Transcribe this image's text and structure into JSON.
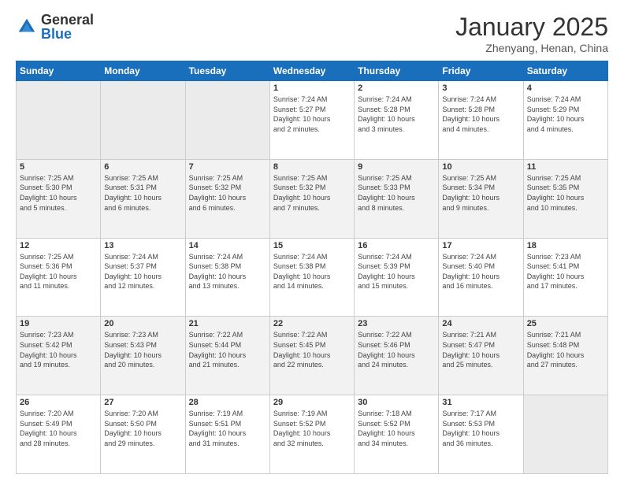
{
  "logo": {
    "general": "General",
    "blue": "Blue"
  },
  "title": "January 2025",
  "location": "Zhenyang, Henan, China",
  "days_of_week": [
    "Sunday",
    "Monday",
    "Tuesday",
    "Wednesday",
    "Thursday",
    "Friday",
    "Saturday"
  ],
  "weeks": [
    [
      {
        "day": null,
        "info": null
      },
      {
        "day": null,
        "info": null
      },
      {
        "day": null,
        "info": null
      },
      {
        "day": "1",
        "info": "Sunrise: 7:24 AM\nSunset: 5:27 PM\nDaylight: 10 hours\nand 2 minutes."
      },
      {
        "day": "2",
        "info": "Sunrise: 7:24 AM\nSunset: 5:28 PM\nDaylight: 10 hours\nand 3 minutes."
      },
      {
        "day": "3",
        "info": "Sunrise: 7:24 AM\nSunset: 5:28 PM\nDaylight: 10 hours\nand 4 minutes."
      },
      {
        "day": "4",
        "info": "Sunrise: 7:24 AM\nSunset: 5:29 PM\nDaylight: 10 hours\nand 4 minutes."
      }
    ],
    [
      {
        "day": "5",
        "info": "Sunrise: 7:25 AM\nSunset: 5:30 PM\nDaylight: 10 hours\nand 5 minutes."
      },
      {
        "day": "6",
        "info": "Sunrise: 7:25 AM\nSunset: 5:31 PM\nDaylight: 10 hours\nand 6 minutes."
      },
      {
        "day": "7",
        "info": "Sunrise: 7:25 AM\nSunset: 5:32 PM\nDaylight: 10 hours\nand 6 minutes."
      },
      {
        "day": "8",
        "info": "Sunrise: 7:25 AM\nSunset: 5:32 PM\nDaylight: 10 hours\nand 7 minutes."
      },
      {
        "day": "9",
        "info": "Sunrise: 7:25 AM\nSunset: 5:33 PM\nDaylight: 10 hours\nand 8 minutes."
      },
      {
        "day": "10",
        "info": "Sunrise: 7:25 AM\nSunset: 5:34 PM\nDaylight: 10 hours\nand 9 minutes."
      },
      {
        "day": "11",
        "info": "Sunrise: 7:25 AM\nSunset: 5:35 PM\nDaylight: 10 hours\nand 10 minutes."
      }
    ],
    [
      {
        "day": "12",
        "info": "Sunrise: 7:25 AM\nSunset: 5:36 PM\nDaylight: 10 hours\nand 11 minutes."
      },
      {
        "day": "13",
        "info": "Sunrise: 7:24 AM\nSunset: 5:37 PM\nDaylight: 10 hours\nand 12 minutes."
      },
      {
        "day": "14",
        "info": "Sunrise: 7:24 AM\nSunset: 5:38 PM\nDaylight: 10 hours\nand 13 minutes."
      },
      {
        "day": "15",
        "info": "Sunrise: 7:24 AM\nSunset: 5:38 PM\nDaylight: 10 hours\nand 14 minutes."
      },
      {
        "day": "16",
        "info": "Sunrise: 7:24 AM\nSunset: 5:39 PM\nDaylight: 10 hours\nand 15 minutes."
      },
      {
        "day": "17",
        "info": "Sunrise: 7:24 AM\nSunset: 5:40 PM\nDaylight: 10 hours\nand 16 minutes."
      },
      {
        "day": "18",
        "info": "Sunrise: 7:23 AM\nSunset: 5:41 PM\nDaylight: 10 hours\nand 17 minutes."
      }
    ],
    [
      {
        "day": "19",
        "info": "Sunrise: 7:23 AM\nSunset: 5:42 PM\nDaylight: 10 hours\nand 19 minutes."
      },
      {
        "day": "20",
        "info": "Sunrise: 7:23 AM\nSunset: 5:43 PM\nDaylight: 10 hours\nand 20 minutes."
      },
      {
        "day": "21",
        "info": "Sunrise: 7:22 AM\nSunset: 5:44 PM\nDaylight: 10 hours\nand 21 minutes."
      },
      {
        "day": "22",
        "info": "Sunrise: 7:22 AM\nSunset: 5:45 PM\nDaylight: 10 hours\nand 22 minutes."
      },
      {
        "day": "23",
        "info": "Sunrise: 7:22 AM\nSunset: 5:46 PM\nDaylight: 10 hours\nand 24 minutes."
      },
      {
        "day": "24",
        "info": "Sunrise: 7:21 AM\nSunset: 5:47 PM\nDaylight: 10 hours\nand 25 minutes."
      },
      {
        "day": "25",
        "info": "Sunrise: 7:21 AM\nSunset: 5:48 PM\nDaylight: 10 hours\nand 27 minutes."
      }
    ],
    [
      {
        "day": "26",
        "info": "Sunrise: 7:20 AM\nSunset: 5:49 PM\nDaylight: 10 hours\nand 28 minutes."
      },
      {
        "day": "27",
        "info": "Sunrise: 7:20 AM\nSunset: 5:50 PM\nDaylight: 10 hours\nand 29 minutes."
      },
      {
        "day": "28",
        "info": "Sunrise: 7:19 AM\nSunset: 5:51 PM\nDaylight: 10 hours\nand 31 minutes."
      },
      {
        "day": "29",
        "info": "Sunrise: 7:19 AM\nSunset: 5:52 PM\nDaylight: 10 hours\nand 32 minutes."
      },
      {
        "day": "30",
        "info": "Sunrise: 7:18 AM\nSunset: 5:52 PM\nDaylight: 10 hours\nand 34 minutes."
      },
      {
        "day": "31",
        "info": "Sunrise: 7:17 AM\nSunset: 5:53 PM\nDaylight: 10 hours\nand 36 minutes."
      },
      {
        "day": null,
        "info": null
      }
    ]
  ]
}
